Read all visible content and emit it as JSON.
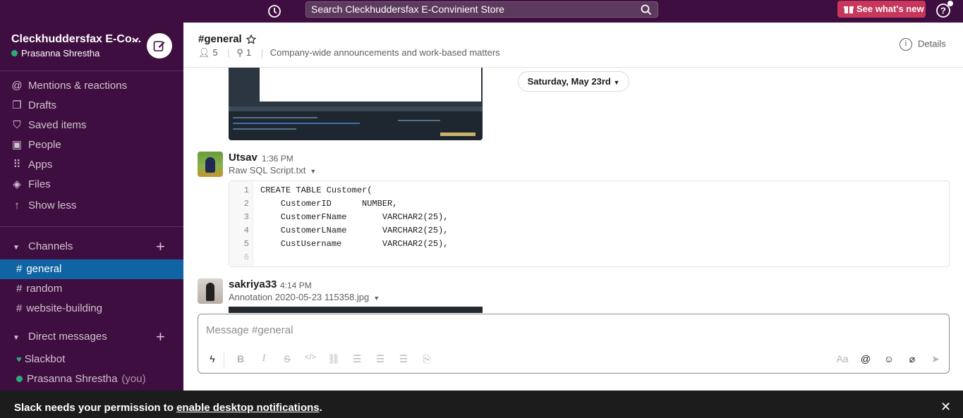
{
  "topbar": {
    "search_placeholder": "Search Cleckhuddersfax E-Convinient Store",
    "whats_new": "See what's new"
  },
  "sidebar": {
    "workspace": "Cleckhuddersfax E-Co...",
    "user": "Prasanna Shrestha",
    "nav": [
      {
        "label": "Mentions & reactions",
        "icon": "at-icon"
      },
      {
        "label": "Drafts",
        "icon": "drafts-icon"
      },
      {
        "label": "Saved items",
        "icon": "bookmark-icon"
      },
      {
        "label": "People",
        "icon": "people-icon"
      },
      {
        "label": "Apps",
        "icon": "apps-grid-icon"
      },
      {
        "label": "Files",
        "icon": "files-stack-icon"
      },
      {
        "label": "Show less",
        "icon": "arrow-up-icon"
      }
    ],
    "channels_header": "Channels",
    "channels": [
      "general",
      "random",
      "website-building"
    ],
    "active_channel": "general",
    "dm_header": "Direct messages",
    "dms": [
      {
        "name": "Slackbot",
        "you": ""
      },
      {
        "name": "Prasanna Shrestha",
        "you": "(you)"
      }
    ]
  },
  "channel": {
    "title": "#general",
    "members": "5",
    "pins": "1",
    "topic": "Company-wide announcements and work-based matters",
    "details": "Details"
  },
  "messages": {
    "date_divider": "Saturday, May 23rd",
    "msg1": {
      "user": "Utsav",
      "time": "1:36 PM",
      "file": "Raw SQL Script.txt",
      "code": [
        {
          "n": "1",
          "t": "CREATE TABLE Customer("
        },
        {
          "n": "2",
          "t": "    CustomerID      NUMBER,"
        },
        {
          "n": "3",
          "t": "    CustomerFName       VARCHAR2(25),"
        },
        {
          "n": "4",
          "t": "    CustomerLName       VARCHAR2(25),"
        },
        {
          "n": "5",
          "t": "    CustUsername        VARCHAR2(25),"
        },
        {
          "n": "6",
          "t": ""
        }
      ]
    },
    "msg2": {
      "user": "sakriya33",
      "time": "4:14 PM",
      "file": "Annotation 2020-05-23 115358.jpg"
    }
  },
  "composer": {
    "placeholder": "Message #general",
    "aa_label": "Aa"
  },
  "banner": {
    "prefix": "Slack needs your permission to ",
    "link": "enable desktop notifications",
    "suffix": "."
  }
}
